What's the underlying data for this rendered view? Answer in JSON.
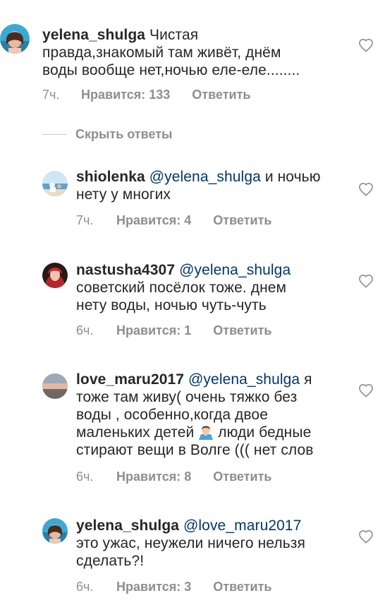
{
  "comments": [
    {
      "username": "yelena_shulga",
      "mention": "",
      "lines": [
        "Чистая",
        "правда,знакомый там живёт, днём",
        "воды вообще нет,ночью еле-еле........"
      ],
      "time": "7ч.",
      "likes": "Нравится: 133",
      "reply": "Ответить",
      "avatar_icon": "profile-photo-woman"
    },
    {
      "username": "shiolenka",
      "mention": "@yelena_shulga",
      "lines": [
        "и ночью",
        "нету у многих"
      ],
      "time": "7ч.",
      "likes": "Нравится: 4",
      "reply": "Ответить",
      "avatar_icon": "profile-photo-beach"
    },
    {
      "username": "nastusha4307",
      "mention": "@yelena_shulga",
      "lines": [
        "",
        "советский посёлок тоже. днем",
        "нету воды, ночью чуть-чуть"
      ],
      "time": "6ч.",
      "likes": "Нравится: 1",
      "reply": "Ответить",
      "avatar_icon": "profile-photo-redhair"
    },
    {
      "username": "love_maru2017",
      "mention": "@yelena_shulga",
      "lines": [
        "я",
        "тоже там живу( очень тяжко без",
        "воды , особенно,когда двое",
        "маленьких детей",
        "люди бедные",
        "стирают вещи в Волге ((( нет слов"
      ],
      "time": "6ч.",
      "likes": "Нравится: 8",
      "reply": "Ответить",
      "avatar_icon": "profile-photo-sunset"
    },
    {
      "username": "yelena_shulga",
      "mention": "@love_maru2017",
      "lines": [
        "",
        "это ужас, неужели ничего нельзя",
        "сделать?!"
      ],
      "time": "6ч.",
      "likes": "Нравится: 3",
      "reply": "Ответить",
      "avatar_icon": "profile-photo-woman"
    }
  ],
  "hide_replies_label": "Скрыть ответы",
  "icons": {
    "like": "heart-outline-icon",
    "emoji": "man-shrugging-emoji"
  },
  "colors": {
    "text": "#262626",
    "mention": "#00376b",
    "meta": "#8e8e8e"
  }
}
